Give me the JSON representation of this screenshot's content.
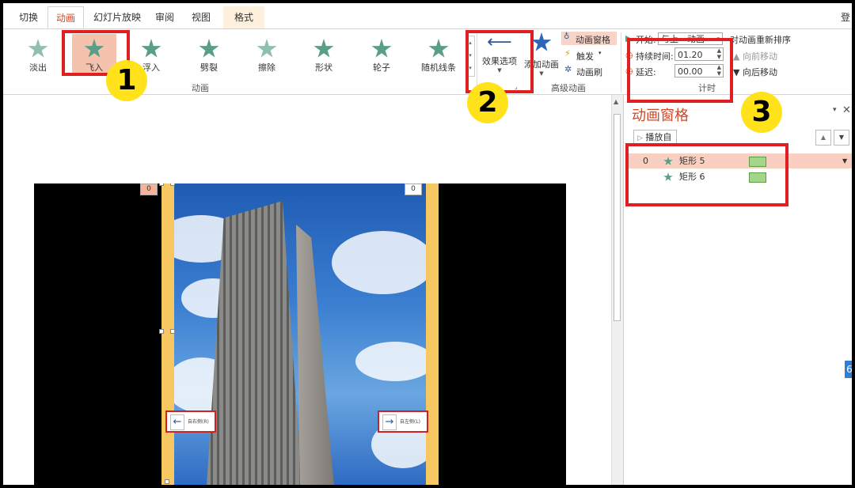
{
  "tabs": [
    "切换",
    "动画",
    "幻灯片放映",
    "审阅",
    "视图",
    "格式"
  ],
  "login": "登",
  "effects": [
    {
      "label": "淡出",
      "icon": "fade-star-icon"
    },
    {
      "label": "飞入",
      "icon": "fly-in-star-icon",
      "selected": true
    },
    {
      "label": "浮入",
      "icon": "float-in-star-icon"
    },
    {
      "label": "劈裂",
      "icon": "split-star-icon"
    },
    {
      "label": "擦除",
      "icon": "wipe-star-icon"
    },
    {
      "label": "形状",
      "icon": "shape-star-icon"
    },
    {
      "label": "轮子",
      "icon": "wheel-star-icon"
    },
    {
      "label": "随机线条",
      "icon": "random-bars-star-icon"
    }
  ],
  "groups": {
    "animation": "动画",
    "advanced": "高级动画",
    "timing": "计时"
  },
  "effect_options": "效果选项",
  "add_animation": "添加动画",
  "advanced": {
    "pane": "动画窗格",
    "trigger": "触发",
    "painter": "动画刷"
  },
  "timing": {
    "start_label": "开始:",
    "start_value": "与上一动画",
    "duration_label": "持续时间:",
    "duration_value": "01.20",
    "delay_label": "延迟:",
    "delay_value": "00.00",
    "reorder": "对动画重新排序",
    "move_earlier": "向前移动",
    "move_later": "向后移动"
  },
  "callouts": [
    "1",
    "2",
    "3"
  ],
  "slide": {
    "tag_left": "0",
    "tag_right": "0",
    "btn_left": "自右侧(R)",
    "btn_right": "自左侧(L)"
  },
  "pane": {
    "title": "动画窗格",
    "play_from": "播放自",
    "items": [
      {
        "index": "0",
        "name": "矩形 5"
      },
      {
        "index": "",
        "name": "矩形 6"
      }
    ]
  },
  "edge_badge": "6"
}
